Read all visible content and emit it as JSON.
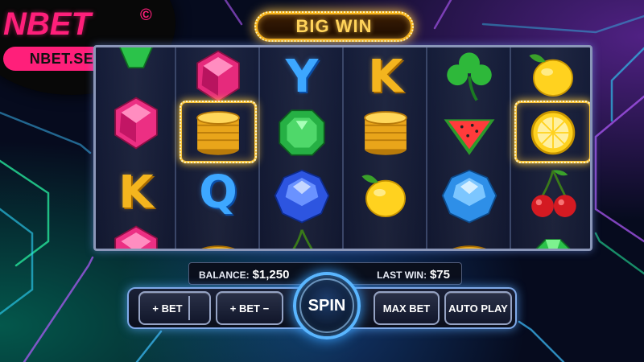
{
  "brand": {
    "name": "NBET",
    "copyright": "©",
    "url": "NBET.SE.NET"
  },
  "banner": {
    "text": "BIG WIN"
  },
  "reels": [
    [
      "gem-green",
      "gem-pink",
      "gem-pink",
      "gem-pink"
    ],
    [
      "gem-pink",
      "coins",
      "Q",
      "coin"
    ],
    [
      "Y",
      "gem-green",
      "gem-blue",
      "cherry"
    ],
    [
      "K",
      "coins",
      "lemon",
      "watermelon"
    ],
    [
      "clover",
      "watermelon",
      "gem-blue",
      "coin"
    ],
    [
      "lemon",
      "lemon-half",
      "cherry",
      "gem-green"
    ]
  ],
  "info": {
    "balance_label": "BALANCE:",
    "balance_value": "$1,250",
    "lastwin_label": "LAST WIN:",
    "lastwin_value": "$75"
  },
  "controls": {
    "bet_plus_label": "+ BET",
    "bet_adjust_label": "+ BET −",
    "spin_label": "SPIN",
    "max_bet_label": "MAX BET",
    "auto_play_label": "AUTO PLAY"
  },
  "colors": {
    "brand_pink": "#ff1f7a",
    "gold": "#f6b21b",
    "neon_blue": "#5ab6ff"
  }
}
